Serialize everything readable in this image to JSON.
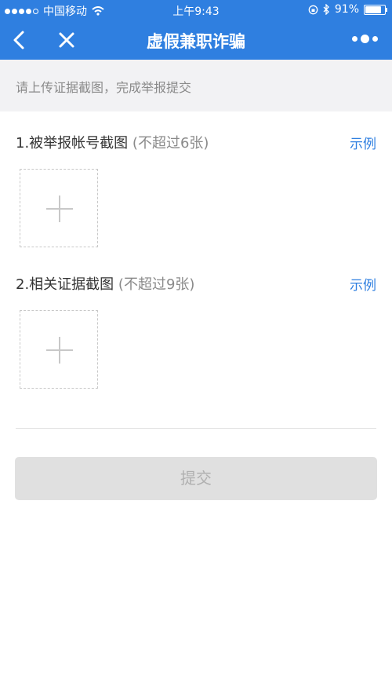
{
  "status_bar": {
    "carrier": "中国移动",
    "time": "上午9:43",
    "battery": "91%",
    "battery_level": 0.91
  },
  "nav": {
    "title": "虚假兼职诈骗"
  },
  "notice": "请上传证据截图，完成举报提交",
  "sections": [
    {
      "title": "1.被举报帐号截图",
      "hint": "(不超过6张)",
      "example": "示例"
    },
    {
      "title": "2.相关证据截图",
      "hint": "(不超过9张)",
      "example": "示例"
    }
  ],
  "submit_label": "提交",
  "colors": {
    "brand": "#2f7fe0",
    "submit_disabled_bg": "#e0e0e0"
  }
}
